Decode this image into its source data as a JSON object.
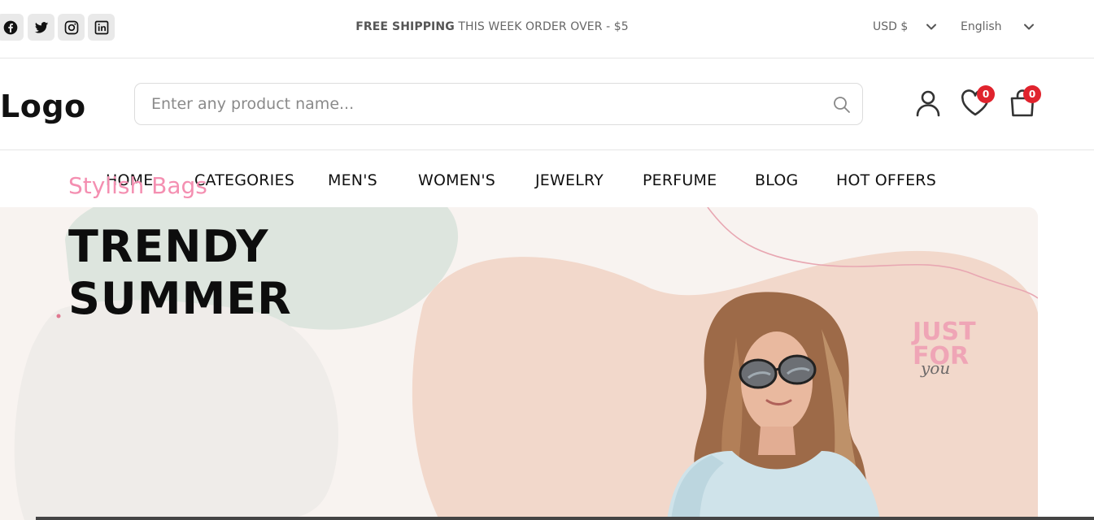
{
  "topbar": {
    "social_icons": [
      "facebook-icon",
      "twitter-icon",
      "instagram-icon",
      "linkedin-icon"
    ],
    "shipping_bold": "FREE SHIPPING",
    "shipping_rest": " THIS WEEK ORDER OVER - $5",
    "currency": "USD $",
    "language": "English"
  },
  "header": {
    "logo": "Logo",
    "search_placeholder": "Enter any product name...",
    "wishlist_count": "0",
    "cart_count": "0"
  },
  "nav": {
    "items": [
      "HOME",
      "CATEGORIES",
      "MEN'S",
      "WOMEN'S",
      "JEWELRY",
      "PERFUME",
      "BLOG",
      "HOT OFFERS"
    ]
  },
  "hero": {
    "subtitle": "Stylish Bags",
    "title": "TRENDY\nSUMMER",
    "stamp_line1": "JUST",
    "stamp_line2": "FOR",
    "stamp_line3": "you"
  },
  "colors": {
    "accent_pink": "#f48fb1",
    "badge_red": "#e0232d",
    "blob_peach": "#f3d9cc",
    "blob_sage": "#dfe6df"
  }
}
